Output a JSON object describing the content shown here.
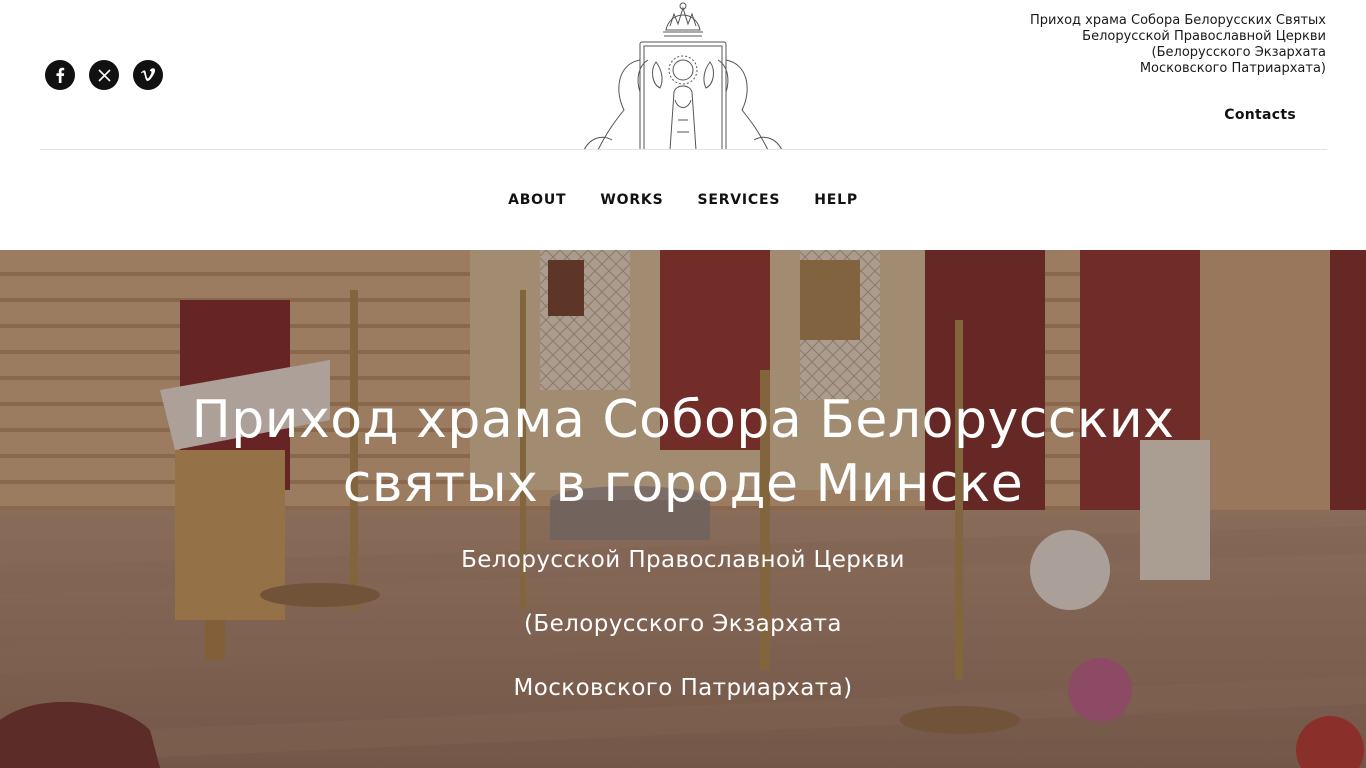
{
  "social": {
    "items": [
      {
        "name": "facebook-icon",
        "glyph": "f"
      },
      {
        "name": "x-twitter-icon",
        "glyph": "𝕏"
      },
      {
        "name": "vimeo-icon",
        "glyph": "v"
      }
    ]
  },
  "header": {
    "org_lines": [
      "Приход храма Собора Белорусских Святых",
      "Белорусской Православной Церкви",
      "(Белорусского Экзархата",
      "Московского Патриархата)"
    ],
    "contacts_label": "Contacts"
  },
  "nav": {
    "items": [
      "ABOUT",
      "WORKS",
      "SERVICES",
      "HELP"
    ]
  },
  "hero": {
    "title_line1": "Приход храма Собора Белорусских",
    "title_line2": "святых в городе Минске",
    "subtitle_lines": [
      "Белорусской Православной Церкви",
      "(Белорусского Экзархата",
      "Московского Патриархата)"
    ]
  },
  "colors": {
    "text": "#111111",
    "divider": "#e3e3e3",
    "hero_text": "#ffffff",
    "wood": "#c9a27a",
    "curtain": "#7a2424"
  }
}
